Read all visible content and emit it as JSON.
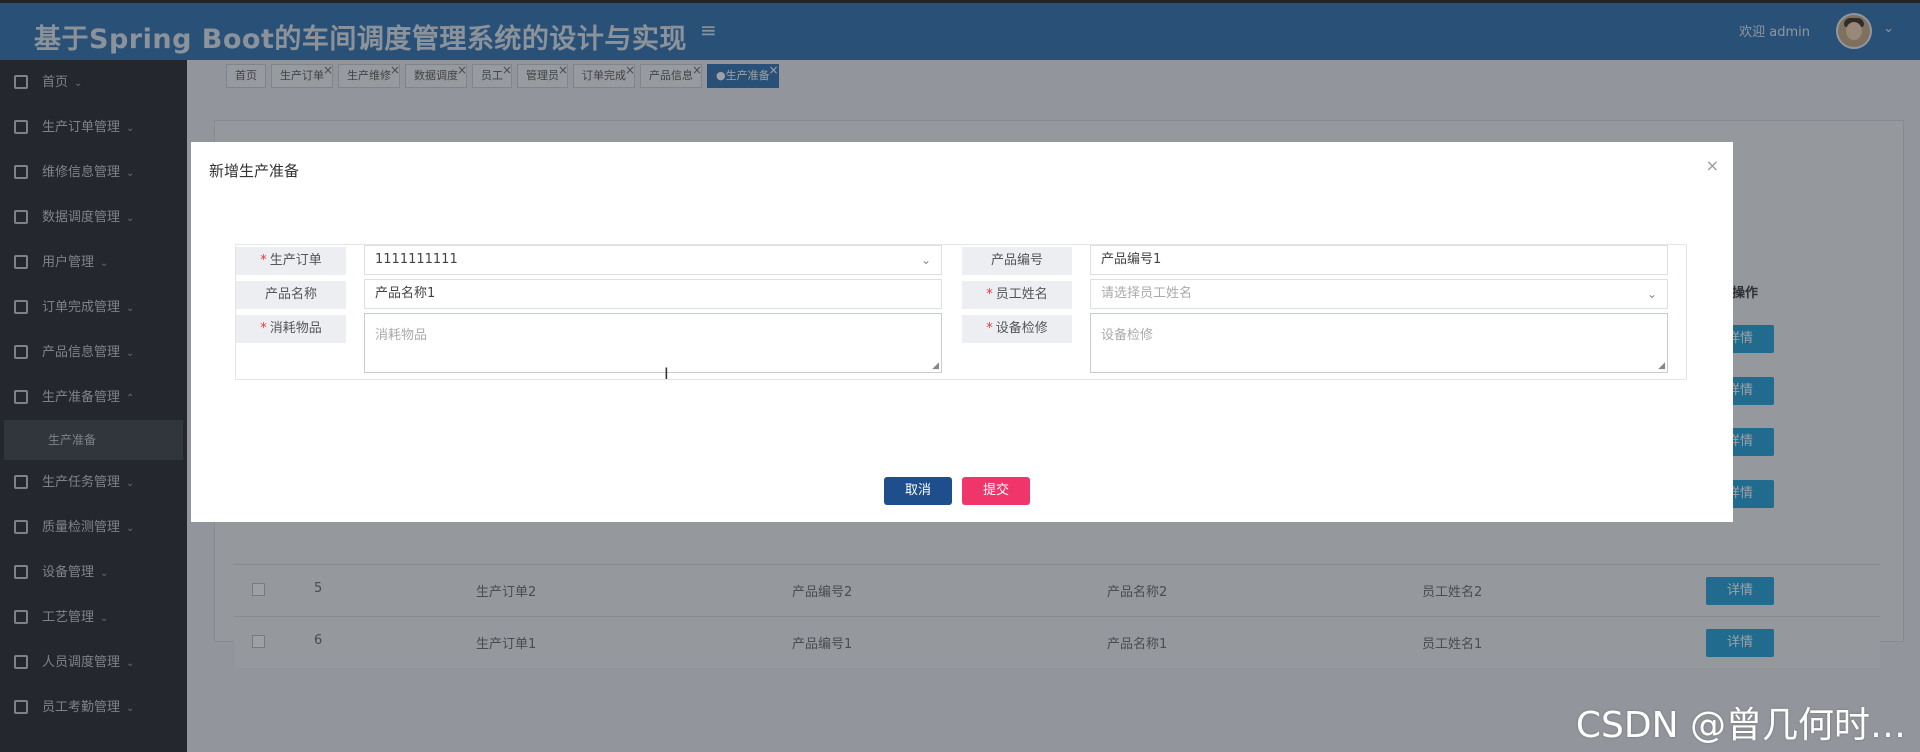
{
  "header": {
    "title": "基于Spring Boot的车间调度管理系统的设计与实现",
    "welcome": "欢迎 admin"
  },
  "sidebar": {
    "items": [
      {
        "label": "首页"
      },
      {
        "label": "生产订单管理"
      },
      {
        "label": "维修信息管理"
      },
      {
        "label": "数据调度管理"
      },
      {
        "label": "用户管理"
      },
      {
        "label": "订单完成管理"
      },
      {
        "label": "产品信息管理"
      },
      {
        "label": "生产准备管理"
      },
      {
        "label": "生产任务管理"
      },
      {
        "label": "质量检测管理"
      },
      {
        "label": "设备管理"
      },
      {
        "label": "工艺管理"
      },
      {
        "label": "人员调度管理"
      },
      {
        "label": "员工考勤管理"
      }
    ],
    "sub_item": "生产准备"
  },
  "tabs": [
    {
      "label": "首页"
    },
    {
      "label": "生产订单"
    },
    {
      "label": "生产维修"
    },
    {
      "label": "数据调度"
    },
    {
      "label": "员工"
    },
    {
      "label": "管理员"
    },
    {
      "label": "订单完成"
    },
    {
      "label": "产品信息"
    },
    {
      "label": "●生产准备"
    }
  ],
  "table": {
    "op_header": "操作",
    "detail_label": "详情",
    "rows": [
      {
        "index": "5",
        "order": "生产订单2",
        "code": "产品编号2",
        "name": "产品名称2",
        "staff": "员工姓名2"
      },
      {
        "index": "6",
        "order": "生产订单1",
        "code": "产品编号1",
        "name": "产品名称1",
        "staff": "员工姓名1"
      }
    ]
  },
  "modal": {
    "title": "新增生产准备",
    "fields": {
      "order_label": "生产订单",
      "order_value": "1111111111",
      "code_label": "产品编号",
      "code_value": "产品编号1",
      "name_label": "产品名称",
      "name_value": "产品名称1",
      "staff_label": "员工姓名",
      "staff_placeholder": "请选择员工姓名",
      "consume_label": "消耗物品",
      "consume_placeholder": "消耗物品",
      "repair_label": "设备检修",
      "repair_placeholder": "设备检修"
    },
    "cancel": "取消",
    "submit": "提交"
  },
  "watermark": "CSDN @曾几何时…",
  "colors": {
    "header": "#2a6fb0",
    "sidebar": "#22252b",
    "cancel": "#1f4e8c",
    "submit": "#f0356b",
    "detail": "#1b9fd9"
  }
}
